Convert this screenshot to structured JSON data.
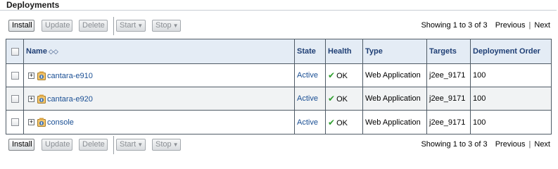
{
  "title": "Deployments",
  "toolbar": {
    "install": "Install",
    "update": "Update",
    "delete": "Delete",
    "start": "Start",
    "stop": "Stop"
  },
  "pager": {
    "showing": "Showing 1 to 3 of 3",
    "previous": "Previous",
    "separator": "|",
    "next": "Next"
  },
  "table": {
    "headers": {
      "name": "Name",
      "state": "State",
      "health": "Health",
      "type": "Type",
      "targets": "Targets",
      "order": "Deployment Order"
    },
    "rows": [
      {
        "name": "cantara-e910",
        "state": "Active",
        "health": "OK",
        "type": "Web Application",
        "targets": "j2ee_9171",
        "order": "100"
      },
      {
        "name": "cantara-e920",
        "state": "Active",
        "health": "OK",
        "type": "Web Application",
        "targets": "j2ee_9171",
        "order": "100"
      },
      {
        "name": "console",
        "state": "Active",
        "health": "OK",
        "type": "Web Application",
        "targets": "j2ee_9171",
        "order": "100"
      }
    ]
  },
  "colors": {
    "header_bg": "#e4ecf5",
    "link": "#1a4f94",
    "ok_green": "#2e9e2e"
  }
}
